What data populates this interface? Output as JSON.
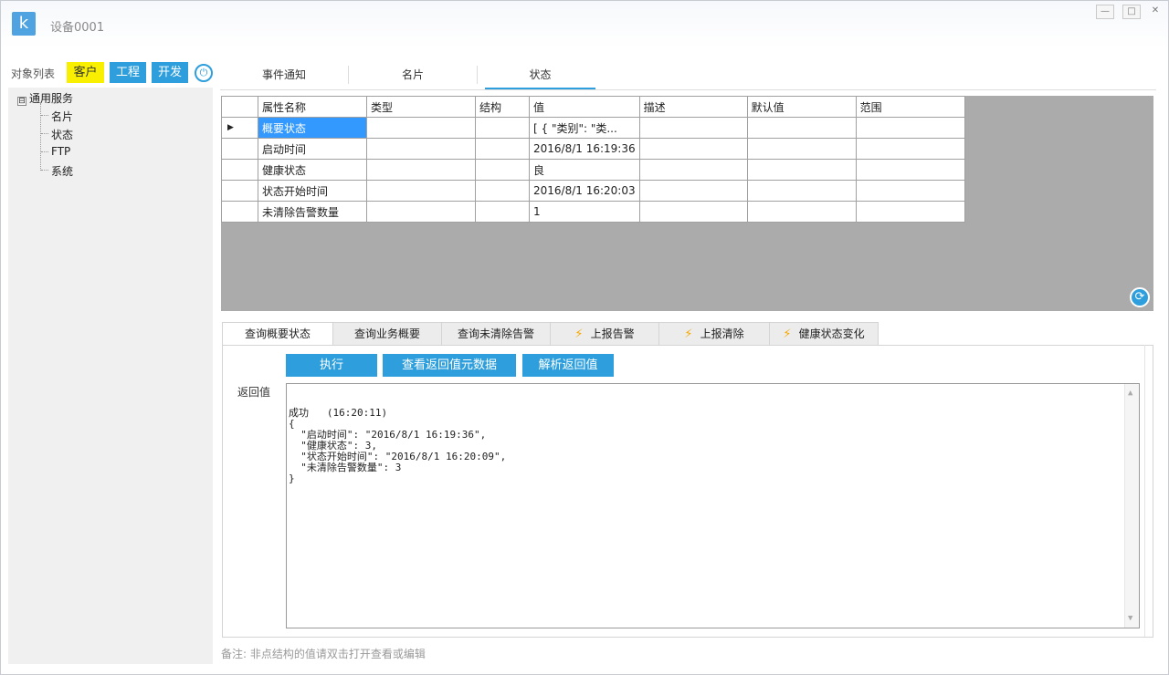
{
  "window": {
    "title": "设备0001",
    "logo_letter": "k",
    "controls": [
      "minimize",
      "maximize",
      "close"
    ]
  },
  "sidebar": {
    "label": "对象列表",
    "buttons": [
      {
        "label": "客户",
        "active": true
      },
      {
        "label": "工程",
        "active": false
      },
      {
        "label": "开发",
        "active": false
      }
    ],
    "power_icon": "power-icon",
    "tree": {
      "expander": "⊟",
      "root": "通用服务",
      "children": [
        "名片",
        "状态",
        "FTP",
        "系统"
      ]
    }
  },
  "top_tabs": [
    {
      "label": "事件通知",
      "selected": false
    },
    {
      "label": "名片",
      "selected": false
    },
    {
      "label": "状态",
      "selected": true
    }
  ],
  "grid": {
    "columns": [
      "属性名称",
      "类型",
      "结构",
      "值",
      "描述",
      "默认值",
      "范围"
    ],
    "rows": [
      [
        "概要状态",
        "",
        "",
        "[ {    \"类别\": \"类...",
        "",
        "",
        ""
      ],
      [
        "启动时间",
        "",
        "",
        "2016/8/1 16:19:36",
        "",
        "",
        ""
      ],
      [
        "健康状态",
        "",
        "",
        "良",
        "",
        "",
        ""
      ],
      [
        "状态开始时间",
        "",
        "",
        "2016/8/1 16:20:03",
        "",
        "",
        ""
      ],
      [
        "未清除告警数量",
        "",
        "",
        "1",
        "",
        "",
        ""
      ]
    ],
    "selected_row": 0,
    "row_indicator": "▶",
    "refresh_icon": "refresh-icon"
  },
  "bottom_tabs": [
    {
      "label": "查询概要状态",
      "icon": "",
      "selected": true
    },
    {
      "label": "查询业务概要",
      "icon": "",
      "selected": false
    },
    {
      "label": "查询未清除告警",
      "icon": "",
      "selected": false
    },
    {
      "label": "上报告警",
      "icon": "lightning-icon",
      "selected": false
    },
    {
      "label": "上报清除",
      "icon": "lightning-icon",
      "selected": false
    },
    {
      "label": "健康状态变化",
      "icon": "lightning-icon",
      "selected": false
    }
  ],
  "actions": {
    "execute": "执行",
    "view_meta": "查看返回值元数据",
    "parse": "解析返回值"
  },
  "result": {
    "label": "返回值",
    "text": "成功   (16:20:11)\n{\n  \"启动时间\": \"2016/8/1 16:19:36\",\n  \"健康状态\": 3,\n  \"状态开始时间\": \"2016/8/1 16:20:09\",\n  \"未清除告警数量\": 3\n}"
  },
  "note": "备注: 非点结构的值请双击打开查看或编辑",
  "colors": {
    "accent": "#2e9fdc",
    "active_button": "#f8f000",
    "grid_background": "#ababab",
    "selection": "#3399ff",
    "bolt": "#f6a800"
  }
}
